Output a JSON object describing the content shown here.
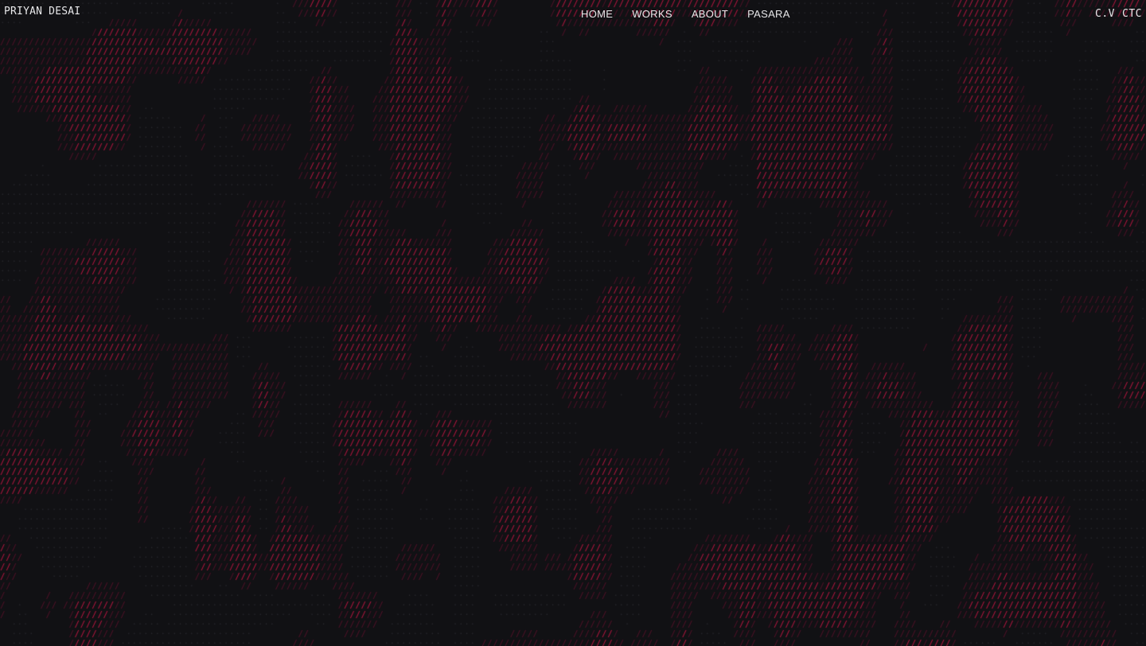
{
  "brand": {
    "name": "PRIYAN DESAI"
  },
  "nav": {
    "items": [
      {
        "label": "HOME"
      },
      {
        "label": "WORKS"
      },
      {
        "label": "ABOUT"
      },
      {
        "label": "PASARA"
      }
    ]
  },
  "utility_nav": {
    "items": [
      {
        "label": "C.V"
      },
      {
        "label": "CTC"
      }
    ]
  },
  "background": {
    "pattern_glyph": "/",
    "dot_glyph": "·",
    "colors": {
      "page": "#111114",
      "accent": "#d8184a",
      "accent_dim": "#6a1230",
      "dot": "#2a2a30"
    }
  }
}
